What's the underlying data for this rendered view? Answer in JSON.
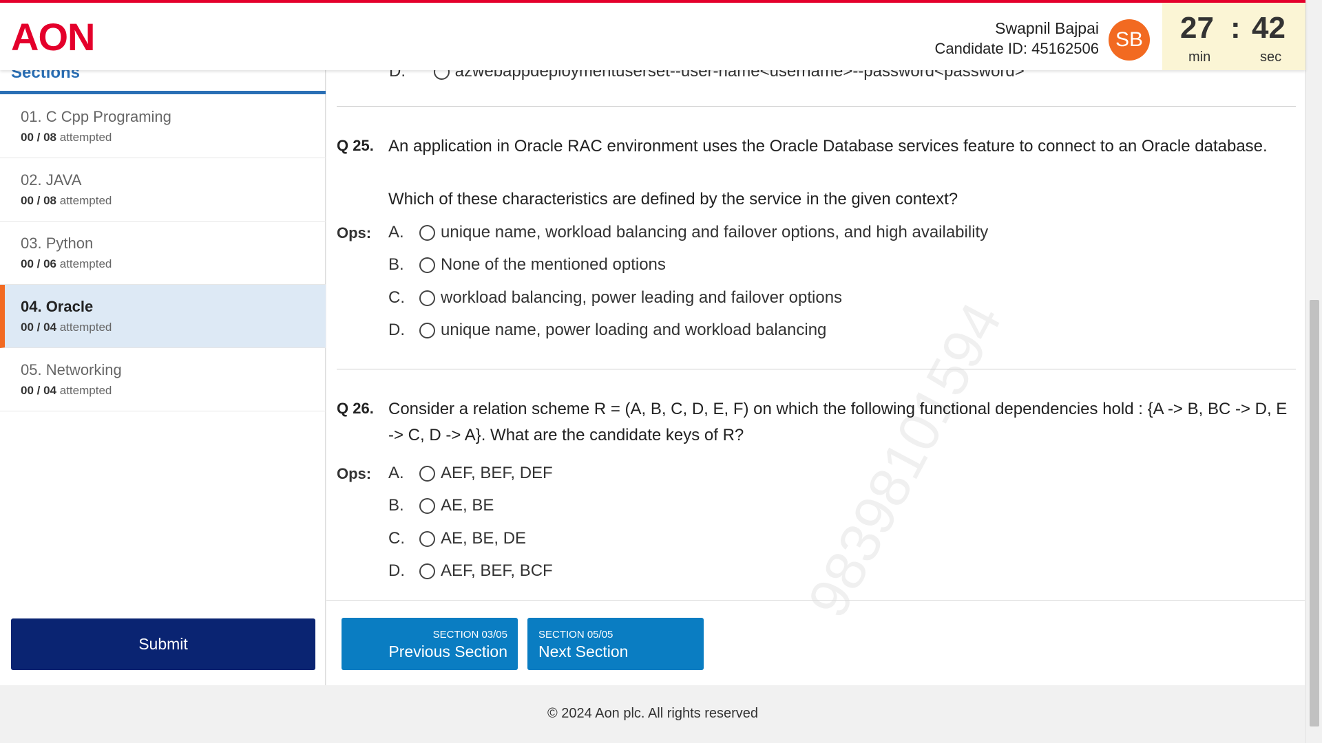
{
  "header": {
    "logo": "AON",
    "user_name": "Swapnil Bajpai",
    "candidate_id": "Candidate ID: 45162506",
    "avatar_initials": "SB",
    "timer": {
      "minutes": "27",
      "separator": ":",
      "seconds": "42",
      "min_label": "min",
      "sec_label": "sec"
    }
  },
  "sidebar": {
    "title": "Sections",
    "items": [
      {
        "name": "01. C Cpp Programing",
        "done": "00",
        "total": "08",
        "suffix": "attempted"
      },
      {
        "name": "02. JAVA",
        "done": "00",
        "total": "08",
        "suffix": "attempted"
      },
      {
        "name": "03. Python",
        "done": "00",
        "total": "06",
        "suffix": "attempted"
      },
      {
        "name": "04. Oracle",
        "done": "00",
        "total": "04",
        "suffix": "attempted"
      },
      {
        "name": "05. Networking",
        "done": "00",
        "total": "04",
        "suffix": "attempted"
      }
    ],
    "submit_label": "Submit"
  },
  "main": {
    "prev_option_letter": "D.",
    "prev_option_text": "azwebappdeploymentuserset--user-name<username>--password<password>",
    "questions": [
      {
        "num": "Q 25.",
        "text": "An application in Oracle RAC environment uses the Oracle Database services feature to connect to an Oracle database.",
        "subtext": "Which of these characteristics are defined by the service in the given context?",
        "ops_label": "Ops:",
        "options": [
          {
            "letter": "A.",
            "text": "unique name, workload balancing and failover options, and high availability"
          },
          {
            "letter": "B.",
            "text": "None of the mentioned options"
          },
          {
            "letter": "C.",
            "text": "workload balancing, power leading and failover options"
          },
          {
            "letter": "D.",
            "text": "unique name, power loading and workload balancing"
          }
        ]
      },
      {
        "num": "Q 26.",
        "text": "Consider a relation scheme R = (A, B, C, D, E, F) on which the following functional dependencies hold : {A -> B, BC -> D, E -> C, D -> A}. What are the candidate keys of R?",
        "ops_label": "Ops:",
        "options": [
          {
            "letter": "A.",
            "text": "AEF, BEF, DEF"
          },
          {
            "letter": "B.",
            "text": "AE, BE"
          },
          {
            "letter": "C.",
            "text": "AE, BE, DE"
          },
          {
            "letter": "D.",
            "text": "AEF, BEF, BCF"
          }
        ]
      }
    ],
    "watermark": "98398101594",
    "prev_button": {
      "small": "SECTION 03/05",
      "big": "Previous Section"
    },
    "next_button": {
      "small": "SECTION 05/05",
      "big": "Next Section"
    }
  },
  "footer": {
    "text": "© 2024 Aon plc. All rights reserved"
  },
  "colors": {
    "brand_red": "#e4002b",
    "accent_orange": "#f26a21",
    "navy": "#0a2472",
    "nav_blue": "#0a7dc2",
    "section_blue": "#2a6fb5"
  }
}
